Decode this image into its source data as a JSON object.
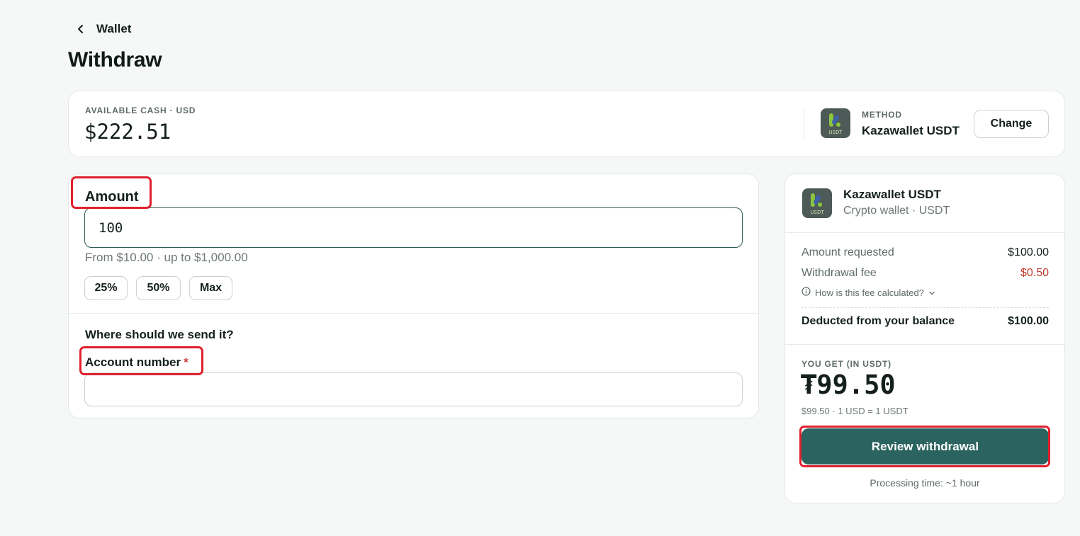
{
  "nav": {
    "back_label": "Wallet"
  },
  "page": {
    "title": "Withdraw"
  },
  "balance": {
    "label": "AVAILABLE CASH · USD",
    "value": "$222.51",
    "method_label": "METHOD",
    "method_name": "Kazawallet USDT",
    "method_logo_text": "USDT",
    "change_label": "Change"
  },
  "form": {
    "amount_label": "Amount",
    "amount_value": "100",
    "range_hint": "From $10.00 · up to $1,000.00",
    "chips": [
      "25%",
      "50%",
      "Max"
    ],
    "send_question": "Where should we send it?",
    "account_label": "Account number",
    "required_mark": "*",
    "account_value": ""
  },
  "summary": {
    "name": "Kazawallet USDT",
    "subtitle": "Crypto wallet · USDT",
    "logo_text": "USDT",
    "amount_requested_label": "Amount requested",
    "amount_requested_value": "$100.00",
    "fee_label": "Withdrawal fee",
    "fee_value": "$0.50",
    "fee_help": "How is this fee calculated?",
    "deducted_label": "Deducted from your balance",
    "deducted_value": "$100.00",
    "you_get_label": "YOU GET (IN USDT)",
    "you_get_value": "₮99.50",
    "rate_text": "$99.50 · 1 USD = 1 USDT",
    "review_label": "Review withdrawal",
    "processing_text": "Processing time: ~1 hour"
  },
  "colors": {
    "accent": "#2b6360",
    "fee": "#c0392b",
    "highlight": "#e0202e",
    "logo_bg": "#4d5a57",
    "logo_green": "#8bc63f",
    "logo_blue": "#3f5fa8"
  }
}
